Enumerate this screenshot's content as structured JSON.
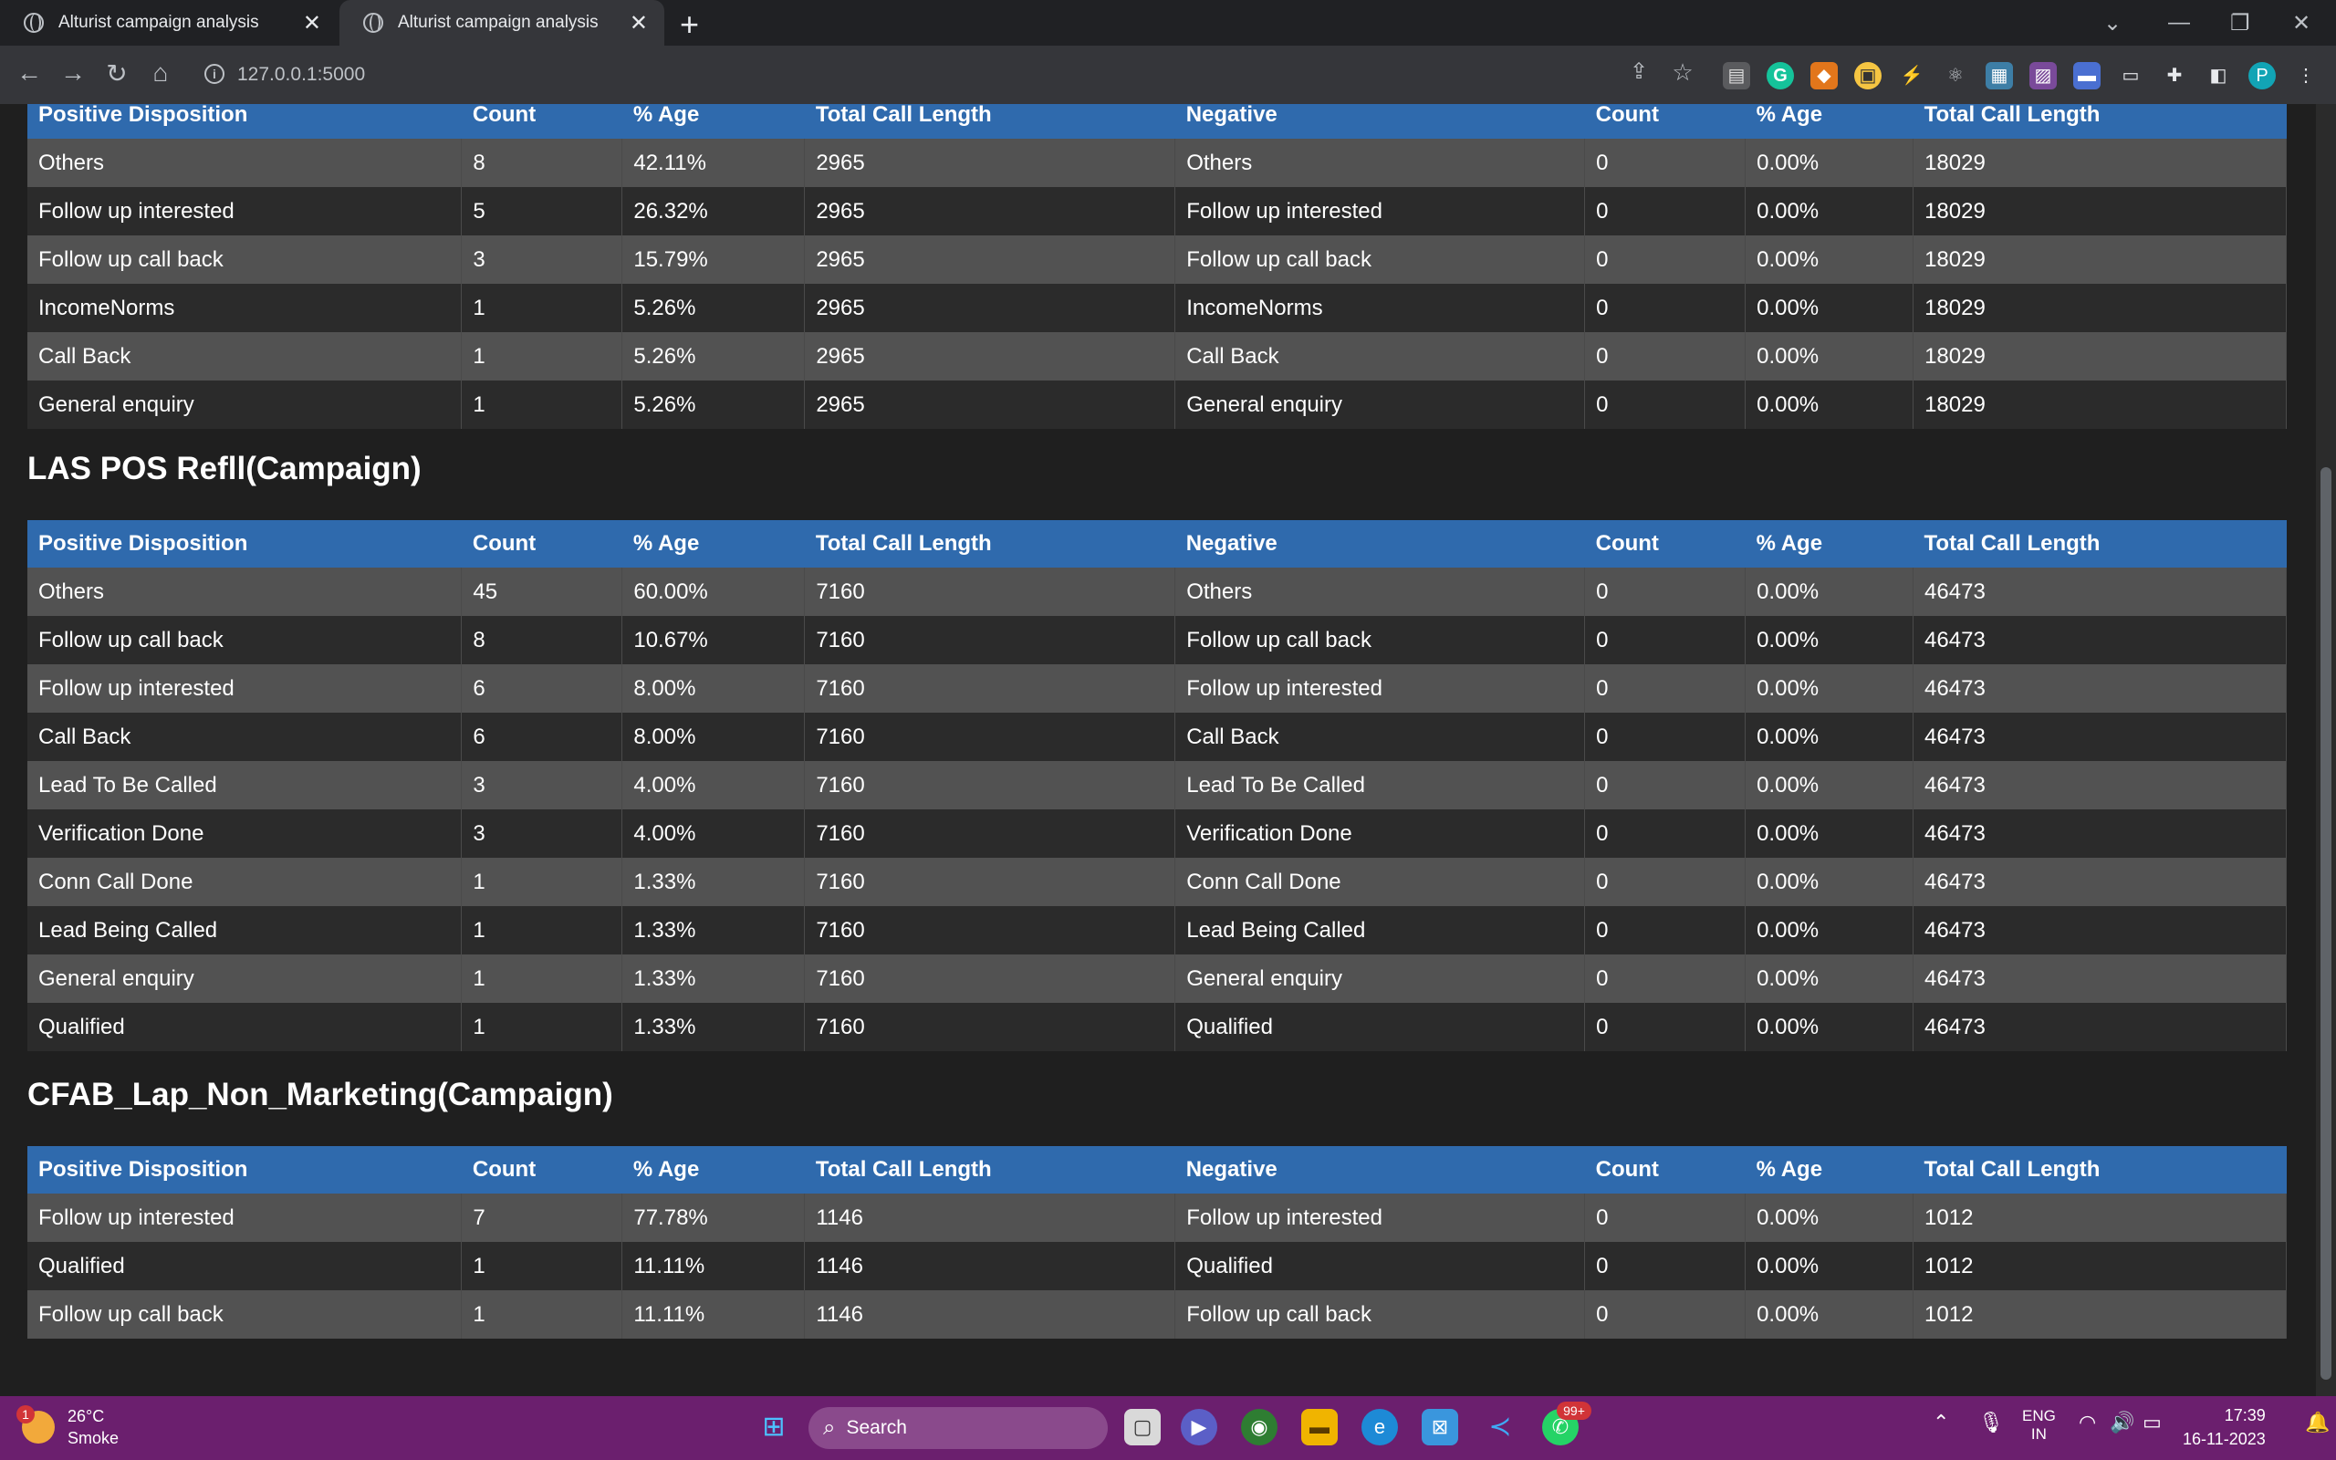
{
  "browser": {
    "tabs": [
      {
        "title": "Alturist campaign analysis"
      },
      {
        "title": "Alturist campaign analysis"
      }
    ],
    "url": "127.0.0.1:5000"
  },
  "headers": [
    "Positive Disposition",
    "Count",
    "% Age",
    "Total Call Length",
    "Negative",
    "Count",
    "% Age",
    "Total Call Length"
  ],
  "sections": [
    {
      "title": "",
      "rows": [
        [
          "Others",
          "8",
          "42.11%",
          "2965",
          "Others",
          "0",
          "0.00%",
          "18029"
        ],
        [
          "Follow up interested",
          "5",
          "26.32%",
          "2965",
          "Follow up interested",
          "0",
          "0.00%",
          "18029"
        ],
        [
          "Follow up call back",
          "3",
          "15.79%",
          "2965",
          "Follow up call back",
          "0",
          "0.00%",
          "18029"
        ],
        [
          "IncomeNorms",
          "1",
          "5.26%",
          "2965",
          "IncomeNorms",
          "0",
          "0.00%",
          "18029"
        ],
        [
          "Call Back",
          "1",
          "5.26%",
          "2965",
          "Call Back",
          "0",
          "0.00%",
          "18029"
        ],
        [
          "General enquiry",
          "1",
          "5.26%",
          "2965",
          "General enquiry",
          "0",
          "0.00%",
          "18029"
        ]
      ]
    },
    {
      "title": "LAS POS Refll(Campaign)",
      "rows": [
        [
          "Others",
          "45",
          "60.00%",
          "7160",
          "Others",
          "0",
          "0.00%",
          "46473"
        ],
        [
          "Follow up call back",
          "8",
          "10.67%",
          "7160",
          "Follow up call back",
          "0",
          "0.00%",
          "46473"
        ],
        [
          "Follow up interested",
          "6",
          "8.00%",
          "7160",
          "Follow up interested",
          "0",
          "0.00%",
          "46473"
        ],
        [
          "Call Back",
          "6",
          "8.00%",
          "7160",
          "Call Back",
          "0",
          "0.00%",
          "46473"
        ],
        [
          "Lead To Be Called",
          "3",
          "4.00%",
          "7160",
          "Lead To Be Called",
          "0",
          "0.00%",
          "46473"
        ],
        [
          "Verification Done",
          "3",
          "4.00%",
          "7160",
          "Verification Done",
          "0",
          "0.00%",
          "46473"
        ],
        [
          "Conn Call Done",
          "1",
          "1.33%",
          "7160",
          "Conn Call Done",
          "0",
          "0.00%",
          "46473"
        ],
        [
          "Lead Being Called",
          "1",
          "1.33%",
          "7160",
          "Lead Being Called",
          "0",
          "0.00%",
          "46473"
        ],
        [
          "General enquiry",
          "1",
          "1.33%",
          "7160",
          "General enquiry",
          "0",
          "0.00%",
          "46473"
        ],
        [
          "Qualified",
          "1",
          "1.33%",
          "7160",
          "Qualified",
          "0",
          "0.00%",
          "46473"
        ]
      ]
    },
    {
      "title": "CFAB_Lap_Non_Marketing(Campaign)",
      "rows": [
        [
          "Follow up interested",
          "7",
          "77.78%",
          "1146",
          "Follow up interested",
          "0",
          "0.00%",
          "1012"
        ],
        [
          "Qualified",
          "1",
          "11.11%",
          "1146",
          "Qualified",
          "0",
          "0.00%",
          "1012"
        ],
        [
          "Follow up call back",
          "1",
          "11.11%",
          "1146",
          "Follow up call back",
          "0",
          "0.00%",
          "1012"
        ]
      ]
    }
  ],
  "taskbar": {
    "weather_temp": "26°C",
    "weather_desc": "Smoke",
    "weather_badge": "1",
    "search_label": "Search",
    "whatsapp_badge": "99+",
    "lang_line1": "ENG",
    "lang_line2": "IN",
    "time": "17:39",
    "date": "16-11-2023"
  },
  "colors": {
    "header_bg": "#2f6aad",
    "row_odd": "#525252",
    "row_even": "#2b2b2b",
    "page_bg": "#1f1f1f",
    "taskbar_bg": "#6b1f6e"
  }
}
